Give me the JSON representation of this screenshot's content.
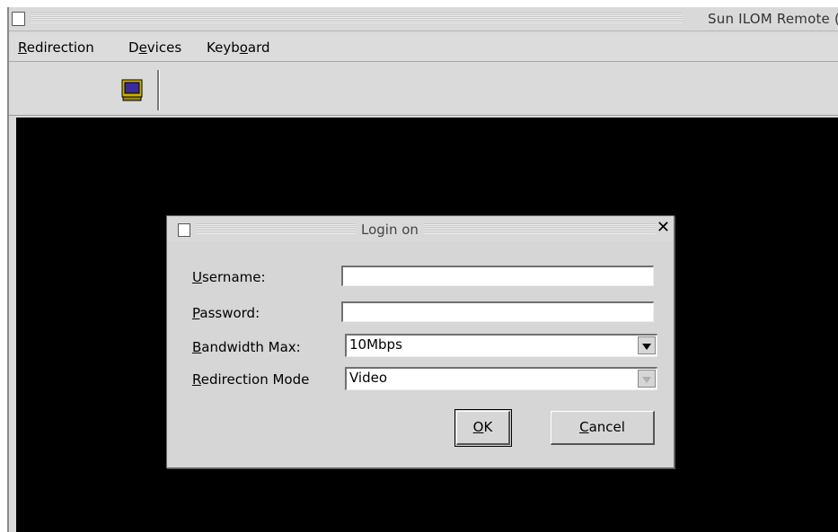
{
  "window": {
    "title": "Sun ILOM Remote ("
  },
  "menubar": {
    "items": [
      {
        "pre": "",
        "u": "R",
        "post": "edirection"
      },
      {
        "pre": "D",
        "u": "e",
        "post": "vices"
      },
      {
        "pre": "Keyb",
        "u": "o",
        "post": "ard"
      }
    ]
  },
  "toolbar": {
    "monitor_icon": "monitor-icon"
  },
  "dialog": {
    "title": "Login on",
    "close_glyph": "✕",
    "fields": {
      "username": {
        "u": "U",
        "rest": "sername:",
        "value": ""
      },
      "password": {
        "u": "P",
        "rest": "assword:",
        "value": ""
      },
      "bandwidth": {
        "u": "B",
        "rest": "andwidth Max:",
        "value": "10Mbps"
      },
      "mode": {
        "u": "R",
        "rest": "edirection Mode",
        "value": "Video"
      }
    },
    "buttons": {
      "ok": {
        "u": "O",
        "rest": "K"
      },
      "cancel": {
        "u": "C",
        "rest": "ancel"
      }
    }
  },
  "colors": {
    "screen": "#000000",
    "chrome": "#d9d9d9"
  }
}
